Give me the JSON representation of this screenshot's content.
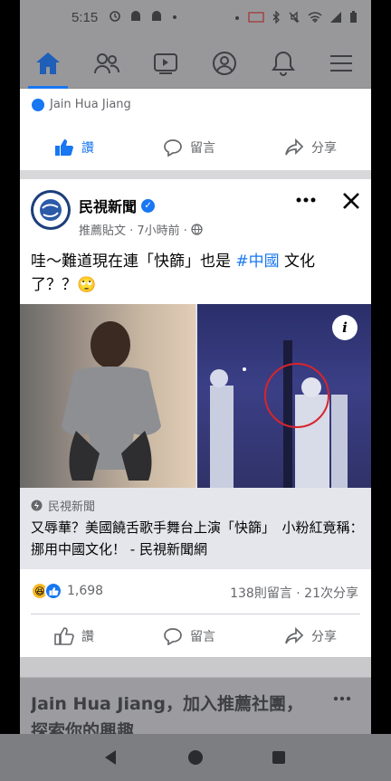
{
  "status_bar": {
    "time": "5:15"
  },
  "nav": {
    "items": [
      "home-icon",
      "friends-icon",
      "watch-icon",
      "profile-icon",
      "notifications-icon",
      "menu-icon"
    ]
  },
  "partial_card": {
    "author": "Jain Hua Jiang"
  },
  "actions": {
    "like": "讚",
    "comment": "留言",
    "share": "分享"
  },
  "post": {
    "page_name": "民視新聞",
    "meta": "推薦貼文 · 7小時前 ·",
    "text_before": "哇～難道現在連「快篩」也是 ",
    "hashtag": "#中國",
    "text_after": " 文化了？？",
    "emoji": "🙄",
    "link_source": "民視新聞",
    "link_title": "又辱華？美國饒舌歌手舞台上演「快篩」　小粉紅竟稱：挪用中國文化！ - 民視新聞網",
    "reaction_count": "1,698",
    "engagement": "138則留言 · 21次分享"
  },
  "suggestion": {
    "text": "Jain Hua Jiang，加入推薦社團，探索你的興趣"
  },
  "colors": {
    "accent": "#1877f2",
    "text_secondary": "#65676b"
  }
}
